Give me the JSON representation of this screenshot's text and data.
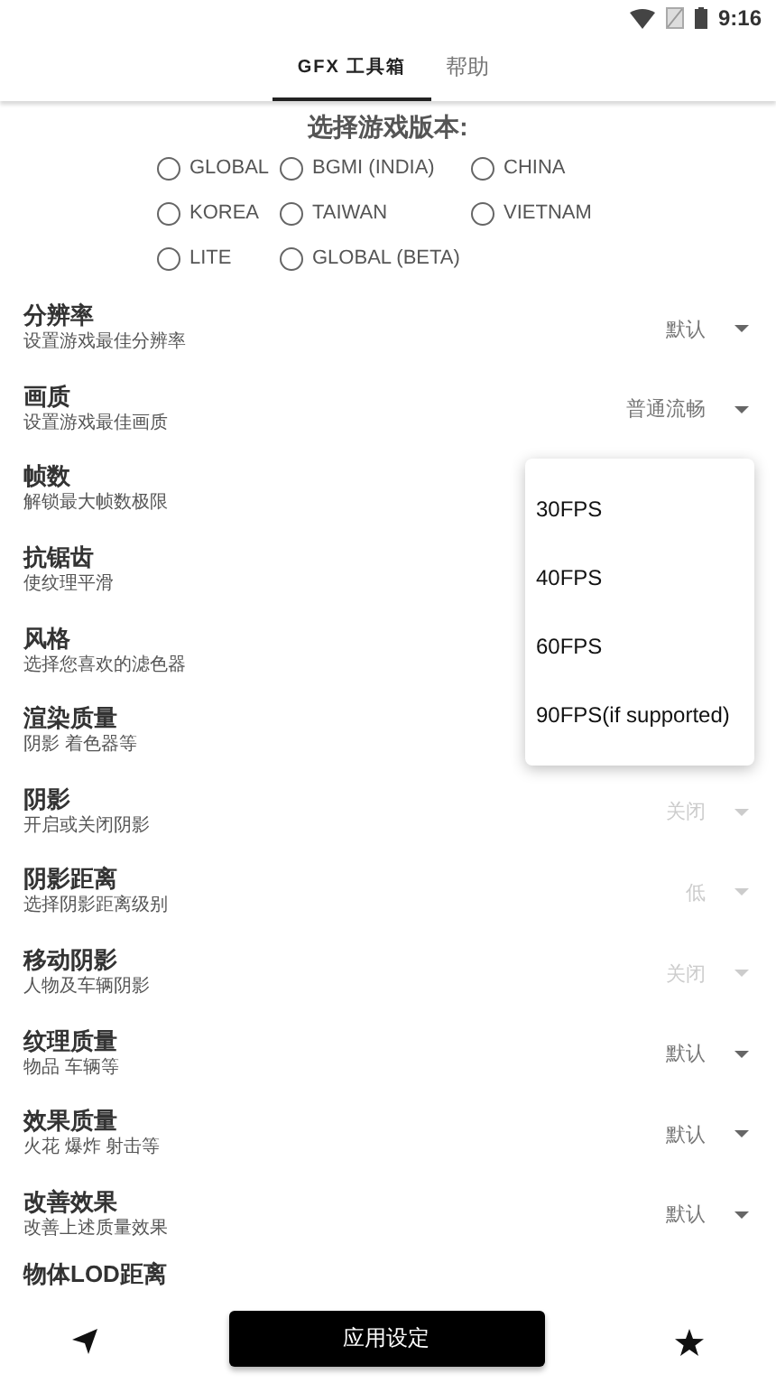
{
  "status_bar": {
    "time": "9:16"
  },
  "tabs": [
    {
      "label": "GFX 工具箱",
      "selected": true
    },
    {
      "label": "帮助",
      "selected": false
    }
  ],
  "version_picker": {
    "title": "选择游戏版本:",
    "options": [
      {
        "label": "GLOBAL",
        "selected": false
      },
      {
        "label": "BGMI (INDIA)",
        "selected": false
      },
      {
        "label": "CHINA",
        "selected": false
      },
      {
        "label": "KOREA",
        "selected": false
      },
      {
        "label": "TAIWAN",
        "selected": false
      },
      {
        "label": "VIETNAM",
        "selected": false
      },
      {
        "label": "LITE",
        "selected": false
      },
      {
        "label": "GLOBAL (BETA)",
        "selected": false
      }
    ]
  },
  "settings": [
    {
      "title": "分辨率",
      "subtitle": "设置游戏最佳分辨率",
      "value": "默认",
      "disabled": false
    },
    {
      "title": "画质",
      "subtitle": "设置游戏最佳画质",
      "value": "普通流畅",
      "disabled": false
    },
    {
      "title": "帧数",
      "subtitle": "解锁最大帧数极限"
    },
    {
      "title": "抗锯齿",
      "subtitle": "使纹理平滑"
    },
    {
      "title": "风格",
      "subtitle": "选择您喜欢的滤色器"
    },
    {
      "title": "渲染质量",
      "subtitle": "阴影 着色器等"
    },
    {
      "title": "阴影",
      "subtitle": "开启或关闭阴影",
      "value": "关闭",
      "disabled": true
    },
    {
      "title": "阴影距离",
      "subtitle": "选择阴影距离级别",
      "value": "低",
      "disabled": true
    },
    {
      "title": "移动阴影",
      "subtitle": "人物及车辆阴影",
      "value": "关闭",
      "disabled": true
    },
    {
      "title": "纹理质量",
      "subtitle": "物品 车辆等",
      "value": "默认",
      "disabled": false
    },
    {
      "title": "效果质量",
      "subtitle": "火花 爆炸 射击等",
      "value": "默认",
      "disabled": false
    },
    {
      "title": "改善效果",
      "subtitle": "改善上述质量效果",
      "value": "默认",
      "disabled": false
    },
    {
      "title": "物体LOD距离"
    }
  ],
  "fps_menu": {
    "options": [
      "30FPS",
      "40FPS",
      "60FPS",
      "90FPS(if supported)"
    ]
  },
  "bottom_bar": {
    "apply_button": "应用设定"
  }
}
